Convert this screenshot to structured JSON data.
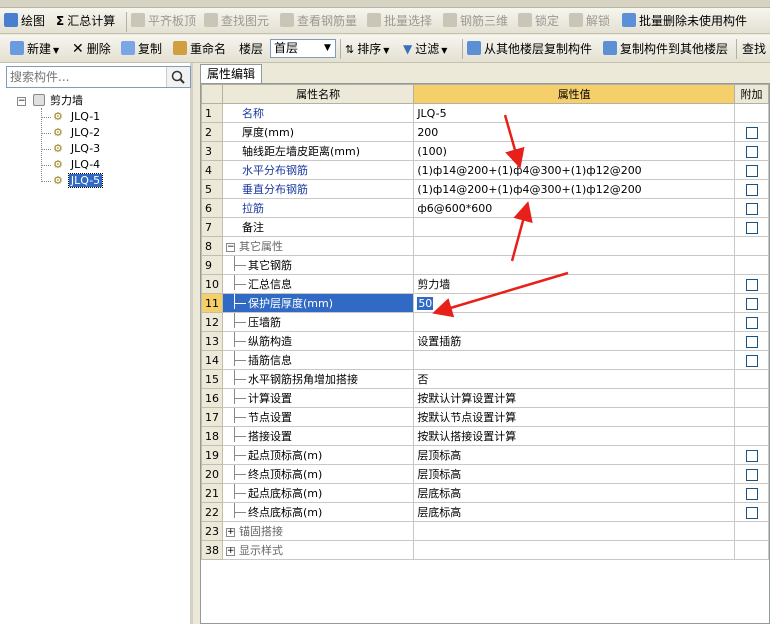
{
  "toolbar1": {
    "items": [
      {
        "label": "绘图",
        "icon": "draw-icon",
        "enabled": true
      },
      {
        "label": "汇总计算",
        "icon": "sigma-icon",
        "enabled": true
      },
      {
        "label": "平齐板顶",
        "icon": "align-icon",
        "enabled": false
      },
      {
        "label": "查找图元",
        "icon": "find-icon",
        "enabled": false
      },
      {
        "label": "查看钢筋量",
        "icon": "view-rebar-icon",
        "enabled": false
      },
      {
        "label": "批量选择",
        "icon": "batch-select-icon",
        "enabled": false
      },
      {
        "label": "钢筋三维",
        "icon": "rebar-3d-icon",
        "enabled": false
      },
      {
        "label": "锁定",
        "icon": "lock-icon",
        "enabled": false
      },
      {
        "label": "解锁",
        "icon": "unlock-icon",
        "enabled": false
      },
      {
        "label": "批量删除未使用构件",
        "icon": "batch-delete-icon",
        "enabled": true
      }
    ]
  },
  "toolbar2": {
    "new_label": "新建",
    "delete_label": "删除",
    "copy_label": "复制",
    "rename_label": "重命名",
    "floor_label": "楼层",
    "floor_value": "首层",
    "sort_label": "排序",
    "filter_label": "过滤",
    "copy_from_floor_label": "从其他楼层复制构件",
    "copy_to_floor_label": "复制构件到其他楼层",
    "find_label": "查找"
  },
  "left_panel": {
    "search_placeholder": "搜索构件...",
    "root_label": "剪力墙",
    "items": [
      "JLQ-1",
      "JLQ-2",
      "JLQ-3",
      "JLQ-4",
      "JLQ-5"
    ],
    "selected_index": 4
  },
  "property_panel": {
    "tab_label": "属性编辑",
    "headers": {
      "name": "属性名称",
      "value": "属性值",
      "attach": "附加"
    },
    "rows": [
      {
        "no": "1",
        "name": "名称",
        "value": "JLQ-5",
        "style": "blue",
        "indent": false,
        "checkbox": false
      },
      {
        "no": "2",
        "name": "厚度(mm)",
        "value": "200",
        "style": "normal",
        "indent": false,
        "checkbox": true
      },
      {
        "no": "3",
        "name": "轴线距左墙皮距离(mm)",
        "value": "(100)",
        "style": "normal",
        "indent": false,
        "checkbox": true
      },
      {
        "no": "4",
        "name": "水平分布钢筋",
        "value": "(1)ф14@200+(1)ф4@300+(1)ф12@200",
        "style": "blue",
        "indent": false,
        "checkbox": true
      },
      {
        "no": "5",
        "name": "垂直分布钢筋",
        "value": "(1)ф14@200+(1)ф4@300+(1)ф12@200",
        "style": "blue",
        "indent": false,
        "checkbox": true
      },
      {
        "no": "6",
        "name": "拉筋",
        "value": "ф6@600*600",
        "style": "blue",
        "indent": false,
        "checkbox": true
      },
      {
        "no": "7",
        "name": "备注",
        "value": "",
        "style": "normal",
        "indent": false,
        "checkbox": true
      },
      {
        "no": "8",
        "name": "其它属性",
        "value": "",
        "style": "grey",
        "indent": false,
        "checkbox": false,
        "expander": "−"
      },
      {
        "no": "9",
        "name": "其它钢筋",
        "value": "",
        "style": "normal",
        "indent": true,
        "checkbox": false
      },
      {
        "no": "10",
        "name": "汇总信息",
        "value": "剪力墙",
        "style": "normal",
        "indent": true,
        "checkbox": true
      },
      {
        "no": "11",
        "name": "保护层厚度(mm)",
        "value": "50",
        "style": "normal",
        "indent": true,
        "checkbox": true,
        "selected": true
      },
      {
        "no": "12",
        "name": "压墙筋",
        "value": "",
        "style": "normal",
        "indent": true,
        "checkbox": true
      },
      {
        "no": "13",
        "name": "纵筋构造",
        "value": "设置插筋",
        "style": "normal",
        "indent": true,
        "checkbox": true
      },
      {
        "no": "14",
        "name": "插筋信息",
        "value": "",
        "style": "normal",
        "indent": true,
        "checkbox": true
      },
      {
        "no": "15",
        "name": "水平钢筋拐角增加搭接",
        "value": "否",
        "style": "normal",
        "indent": true,
        "checkbox": false
      },
      {
        "no": "16",
        "name": "计算设置",
        "value": "按默认计算设置计算",
        "style": "normal",
        "indent": true,
        "checkbox": false
      },
      {
        "no": "17",
        "name": "节点设置",
        "value": "按默认节点设置计算",
        "style": "normal",
        "indent": true,
        "checkbox": false
      },
      {
        "no": "18",
        "name": "搭接设置",
        "value": "按默认搭接设置计算",
        "style": "normal",
        "indent": true,
        "checkbox": false
      },
      {
        "no": "19",
        "name": "起点顶标高(m)",
        "value": "层顶标高",
        "style": "normal",
        "indent": true,
        "checkbox": true
      },
      {
        "no": "20",
        "name": "终点顶标高(m)",
        "value": "层顶标高",
        "style": "normal",
        "indent": true,
        "checkbox": true
      },
      {
        "no": "21",
        "name": "起点底标高(m)",
        "value": "层底标高",
        "style": "normal",
        "indent": true,
        "checkbox": true
      },
      {
        "no": "22",
        "name": "终点底标高(m)",
        "value": "层底标高",
        "style": "normal",
        "indent": true,
        "checkbox": true
      },
      {
        "no": "23",
        "name": "锚固搭接",
        "value": "",
        "style": "grey",
        "indent": false,
        "checkbox": false,
        "expander": "+"
      },
      {
        "no": "38",
        "name": "显示样式",
        "value": "",
        "style": "grey",
        "indent": false,
        "checkbox": false,
        "expander": "+"
      }
    ]
  },
  "colors": {
    "annotation_arrow": "#e8201a",
    "selection": "#316ac5",
    "header_highlight": "#f5cf6a",
    "property_blue": "#1b3aa0"
  }
}
